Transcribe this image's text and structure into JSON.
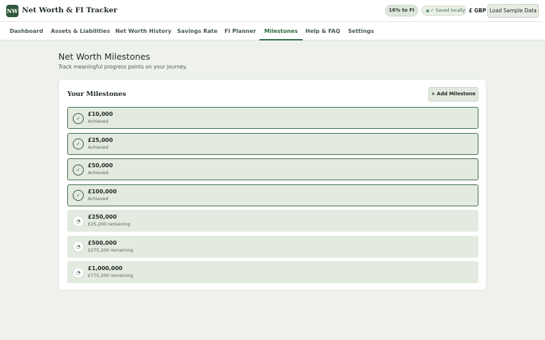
{
  "app": {
    "logo_text": "NW",
    "title": "Net Worth & FI Tracker",
    "fi_progress": "16% to FI",
    "saved_status": "✓ Saved locally",
    "currency": "£ GBP",
    "load_sample_label": "Load Sample Data"
  },
  "tabs": [
    {
      "label": "Dashboard",
      "active": false
    },
    {
      "label": "Assets & Liabilities",
      "active": false
    },
    {
      "label": "Net Worth History",
      "active": false
    },
    {
      "label": "Savings Rate",
      "active": false
    },
    {
      "label": "FI Planner",
      "active": false
    },
    {
      "label": "Milestones",
      "active": true
    },
    {
      "label": "Help & FAQ",
      "active": false
    },
    {
      "label": "Settings",
      "active": false
    }
  ],
  "page": {
    "title": "Net Worth Milestones",
    "subtitle": "Track meaningful progress points on your journey."
  },
  "card": {
    "title": "Your Milestones",
    "add_label": "+ Add Milestone"
  },
  "icons": {
    "achieved": "✓",
    "pending": "◔"
  },
  "milestones": [
    {
      "amount": "£10,000",
      "status": "Achieved",
      "achieved": true
    },
    {
      "amount": "£25,000",
      "status": "Achieved",
      "achieved": true
    },
    {
      "amount": "£50,000",
      "status": "Achieved",
      "achieved": true
    },
    {
      "amount": "£100,000",
      "status": "Achieved",
      "achieved": true
    },
    {
      "amount": "£250,000",
      "status": "£25,200 remaining",
      "achieved": false
    },
    {
      "amount": "£500,000",
      "status": "£275,200 remaining",
      "achieved": false
    },
    {
      "amount": "£1,000,000",
      "status": "£775,200 remaining",
      "achieved": false
    }
  ]
}
